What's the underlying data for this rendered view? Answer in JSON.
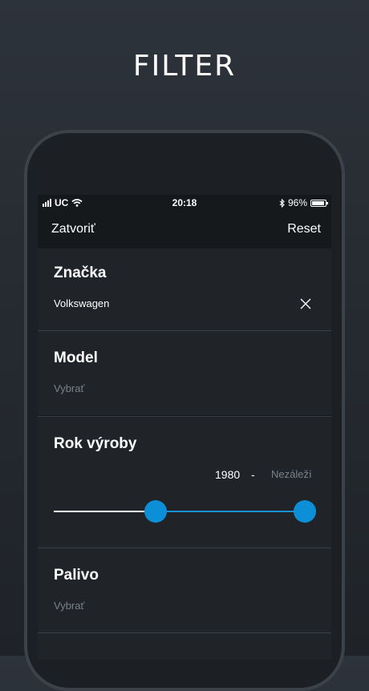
{
  "promo": {
    "title": "FILTER"
  },
  "status_bar": {
    "carrier": "UC",
    "time": "20:18",
    "battery": "96%",
    "battery_level": 0.96
  },
  "nav": {
    "close_label": "Zatvoriť",
    "reset_label": "Reset"
  },
  "filters": {
    "brand": {
      "title": "Značka",
      "value": "Volkswagen"
    },
    "model": {
      "title": "Model",
      "placeholder": "Vybrať"
    },
    "year": {
      "title": "Rok výroby",
      "from": "1980",
      "separator": "-",
      "to": "Nezáleží"
    },
    "fuel": {
      "title": "Palivo",
      "placeholder": "Vybrať"
    }
  },
  "colors": {
    "accent": "#0d8fd8",
    "panel": "#202428",
    "divider": "#3a4047"
  }
}
